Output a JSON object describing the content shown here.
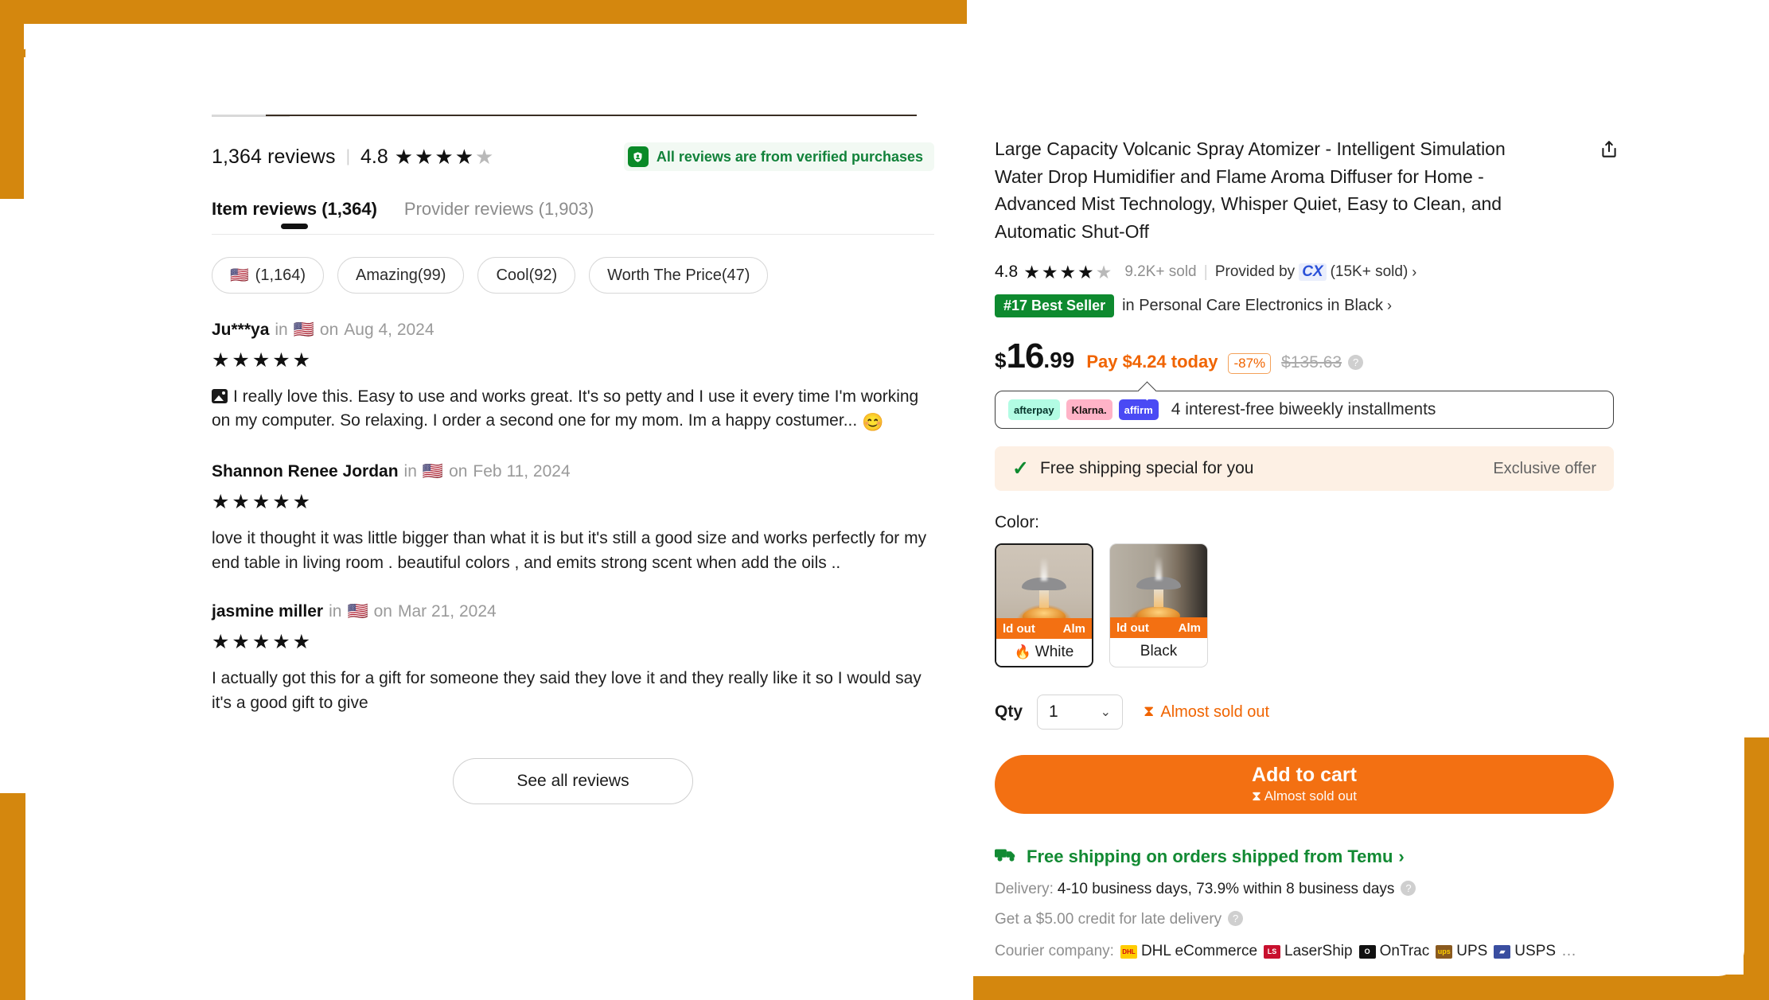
{
  "reviews_panel": {
    "summary": {
      "count_text": "1,364 reviews",
      "rating": "4.8",
      "stars": "★★★★★",
      "verified_badge": "All reviews are from verified purchases",
      "verified_icon": "shield-person-icon"
    },
    "tabs": [
      {
        "label": "Item reviews (1,364)",
        "active": true
      },
      {
        "label": "Provider reviews (1,903)",
        "active": false
      }
    ],
    "filter_chips": [
      {
        "flag": "🇺🇸",
        "label": "(1,164)"
      },
      {
        "flag": "",
        "label": "Amazing(99)"
      },
      {
        "flag": "",
        "label": "Cool(92)"
      },
      {
        "flag": "",
        "label": "Worth The Price(47)"
      }
    ],
    "items": [
      {
        "name": "Ju***ya",
        "in_label": "in",
        "flag": "🇺🇸",
        "on_label": "on",
        "date": "Aug 4, 2024",
        "stars": "★★★★★",
        "has_photo": true,
        "body": "I really love this. Easy to use and works great. It's so petty and I use it every time I'm working on my computer. So relaxing. I order a second one for my mom. Im a happy costumer...",
        "emoji": "😊"
      },
      {
        "name": "Shannon Renee Jordan",
        "in_label": "in",
        "flag": "🇺🇸",
        "on_label": "on",
        "date": "Feb 11, 2024",
        "stars": "★★★★★",
        "has_photo": false,
        "body": "love it thought it was little bigger than what it is but it's still a good size and works perfectly for my end table in living room . beautiful colors , and emits strong scent when add the oils ..",
        "emoji": ""
      },
      {
        "name": "jasmine miller",
        "in_label": "in",
        "flag": "🇺🇸",
        "on_label": "on",
        "date": "Mar 21, 2024",
        "stars": "★★★★★",
        "has_photo": false,
        "body": "I actually got this for a gift for someone they said they love it and they really like it so I would say it's a good gift to give",
        "emoji": ""
      }
    ],
    "see_all_button": "See all reviews"
  },
  "product": {
    "title": "Large Capacity Volcanic Spray Atomizer - Intelligent Simulation Water Drop Humidifier and Flame Aroma Diffuser for Home - Advanced Mist Technology, Whisper Quiet, Easy to Clean, and Automatic Shut-Off",
    "share_icon": "share-icon",
    "rating": {
      "value": "4.8",
      "stars": "★★★★★",
      "sold": "9.2K+ sold",
      "provided_by_label": "Provided by",
      "provider": "CX",
      "provider_sold": "(15K+ sold)",
      "chevron": "›"
    },
    "bestseller": {
      "badge": "#17 Best Seller",
      "text": "in Personal Care Electronics in Black",
      "chevron": "›"
    },
    "price": {
      "currency": "$",
      "integer": "16",
      "decimal": ".99",
      "pay_today": "Pay $4.24 today",
      "discount": "-87%",
      "original": "$135.63",
      "help_icon": "question-mark-icon"
    },
    "installments": {
      "providers": [
        "afterpay",
        "Klarna.",
        "affirm"
      ],
      "text": "4 interest-free biweekly installments"
    },
    "shipping_special": {
      "check_icon": "check-icon",
      "text": "Free shipping special for you",
      "right_text": "Exclusive offer"
    },
    "color": {
      "label": "Color:",
      "options": [
        {
          "name": "White",
          "marquee_left": "ld out",
          "marquee_right": "Alm",
          "selected": true,
          "flame": "🔥"
        },
        {
          "name": "Black",
          "marquee_left": "ld out",
          "marquee_right": "Alm",
          "selected": false,
          "flame": ""
        }
      ]
    },
    "qty": {
      "label": "Qty",
      "value": "1",
      "chevron_icon": "chevron-down-icon",
      "stock_warning": "Almost sold out",
      "stock_icon": "hourglass-icon"
    },
    "add_to_cart": {
      "main": "Add to cart",
      "sub": "Almost sold out",
      "sub_icon": "hourglass-icon",
      "color": "#f37012"
    },
    "shipping": {
      "headline": "Free shipping on orders shipped from Temu",
      "headline_chevron": "›",
      "truck_icon": "truck-icon",
      "delivery_label": "Delivery:",
      "delivery_value": "4-10 business days, 73.9% within 8 business days",
      "credit_text": "Get a $5.00 credit for late delivery",
      "courier_label": "Courier company:",
      "couriers": [
        "DHL eCommerce",
        "LaserShip",
        "OnTrac",
        "UPS",
        "USPS"
      ],
      "courier_ellipsis": "…"
    }
  },
  "colors": {
    "accent_orange": "#f37012",
    "green": "#128a33",
    "frame_orange": "#d4870e"
  }
}
